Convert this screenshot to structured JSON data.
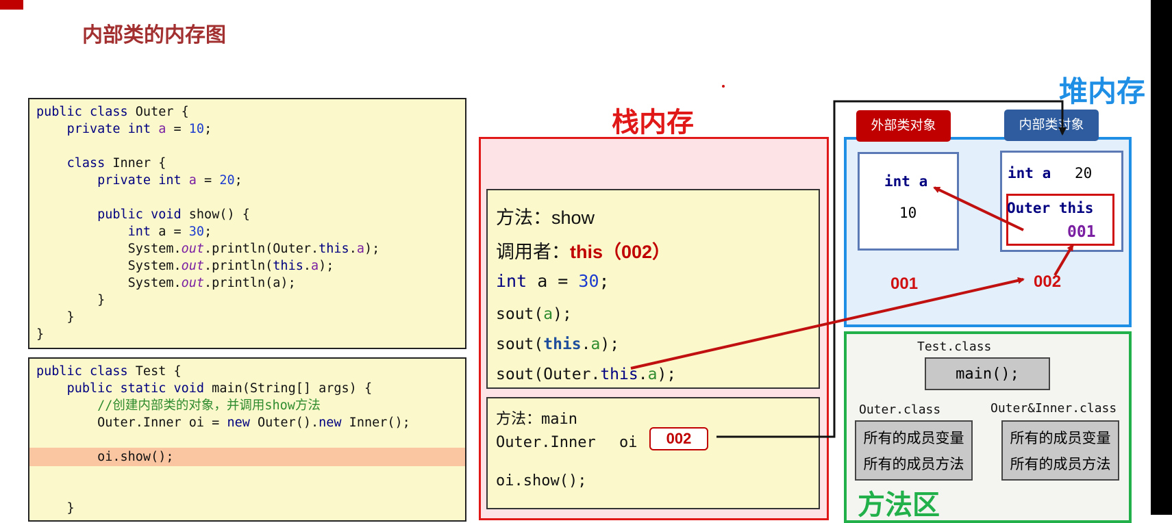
{
  "page_title": "内部类的内存图",
  "code_outer": {
    "lines": [
      "public class Outer {",
      "    private int a = 10;",
      "",
      "    class Inner {",
      "        private int a = 20;",
      "",
      "        public void show() {",
      "            int a = 30;",
      "            System.out.println(Outer.this.a);",
      "            System.out.println(this.a);",
      "            System.out.println(a);",
      "        }",
      "    }",
      "}"
    ]
  },
  "code_test": {
    "lines": [
      "public class Test {",
      "    public static void main(String[] args) {",
      "        //创建内部类的对象，并调用show方法",
      "        Outer.Inner oi = new Outer().new Inner();",
      "",
      "        oi.show();",
      "",
      "",
      "    }"
    ],
    "highlighted_line": 5
  },
  "stack": {
    "title": "栈内存",
    "show_frame": {
      "method_label": "方法：",
      "method_name": "show",
      "caller_label": "调用者：",
      "caller_value": "this（002）",
      "local_var": "int a = 30;",
      "sout_a": "sout(a);",
      "sout_this_a": "sout(this.a);",
      "sout_outer_this_a": "sout(Outer.this.a);"
    },
    "main_frame": {
      "method_label": "方法：",
      "method_name": "main",
      "var_type": "Outer.Inner",
      "var_name": "oi",
      "var_value": "002",
      "call": "oi.show();"
    }
  },
  "heap": {
    "title": "堆内存",
    "outer_obj": {
      "tag": "外部类对象",
      "field": "int a",
      "value": "10",
      "address": "001"
    },
    "inner_obj": {
      "tag": "内部类对象",
      "field": "int a",
      "value": "20",
      "outer_ref_label": "Outer this",
      "outer_ref_value": "001",
      "address": "002"
    },
    "colors": {
      "outer_tag": "#c00000",
      "inner_tag": "#2e5c9e"
    }
  },
  "method_area": {
    "title": "方法区",
    "test_class": {
      "name": "Test.class",
      "method": "main();"
    },
    "outer_class": {
      "name": "Outer.class",
      "line1": "所有的成员变量",
      "line2": "所有的成员方法"
    },
    "inner_class": {
      "name": "Outer&Inner.class",
      "line1": "所有的成员变量",
      "line2": "所有的成员方法"
    }
  },
  "colors": {
    "stack": "#e01818",
    "heap": "#1f8fe6",
    "method_area": "#22b04a",
    "arrow": "#c01010"
  }
}
